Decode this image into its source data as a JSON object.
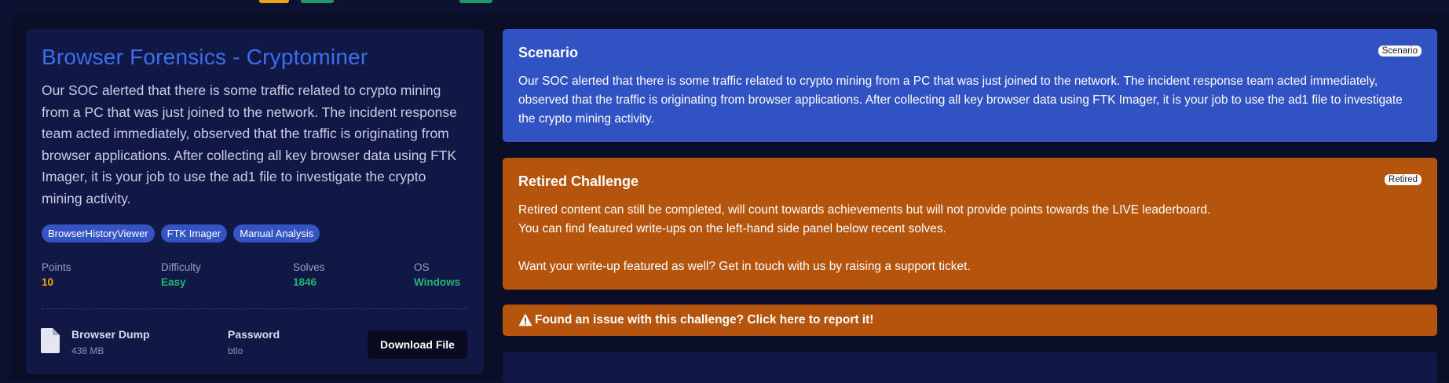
{
  "challenge": {
    "title": "Browser Forensics - Cryptominer",
    "description": "Our SOC alerted that there is some traffic related to crypto mining from a PC that was just joined to the network. The incident response team acted immediately, observed that the traffic is originating from browser applications. After collecting all key browser data using FTK Imager, it is your job to use the ad1 file to investigate the crypto mining activity.",
    "tags": [
      "BrowserHistoryViewer",
      "FTK Imager",
      "Manual Analysis"
    ],
    "stats": {
      "points": {
        "label": "Points",
        "value": "10"
      },
      "difficulty": {
        "label": "Difficulty",
        "value": "Easy"
      },
      "solves": {
        "label": "Solves",
        "value": "1846"
      },
      "os": {
        "label": "OS",
        "value": "Windows"
      }
    },
    "file": {
      "name": "Browser Dump",
      "size": "438 MB",
      "password_label": "Password",
      "password": "btlo",
      "download_label": "Download File",
      "icon": "file-icon"
    }
  },
  "scenario": {
    "title": "Scenario",
    "badge": "Scenario",
    "text": "Our SOC alerted that there is some traffic related to crypto mining from a PC that was just joined to the network. The incident response team acted immediately, observed that the traffic is originating from browser applications. After collecting all key browser data using FTK Imager, it is your job to use the ad1 file to investigate the crypto mining activity."
  },
  "retired": {
    "title": "Retired Challenge",
    "badge": "Retired",
    "line1": "Retired content can still be completed, will count towards achievements but will not provide points towards the LIVE leaderboard.",
    "line2": "You can find featured write-ups on the left-hand side panel below recent solves.",
    "line3": "Want your write-up featured as well? Get in touch with us by raising a support ticket."
  },
  "issue": {
    "text": "Found an issue with this challenge? Click here to report it!",
    "icon": "warning-icon"
  },
  "colors": {
    "background": "#0d1130",
    "card": "#121845",
    "title": "#3c6ff0",
    "tag": "#3454c4",
    "points": "#f0a500",
    "success": "#22b573",
    "scenario_panel": "#3152c2",
    "retired_panel": "#b4540d"
  }
}
